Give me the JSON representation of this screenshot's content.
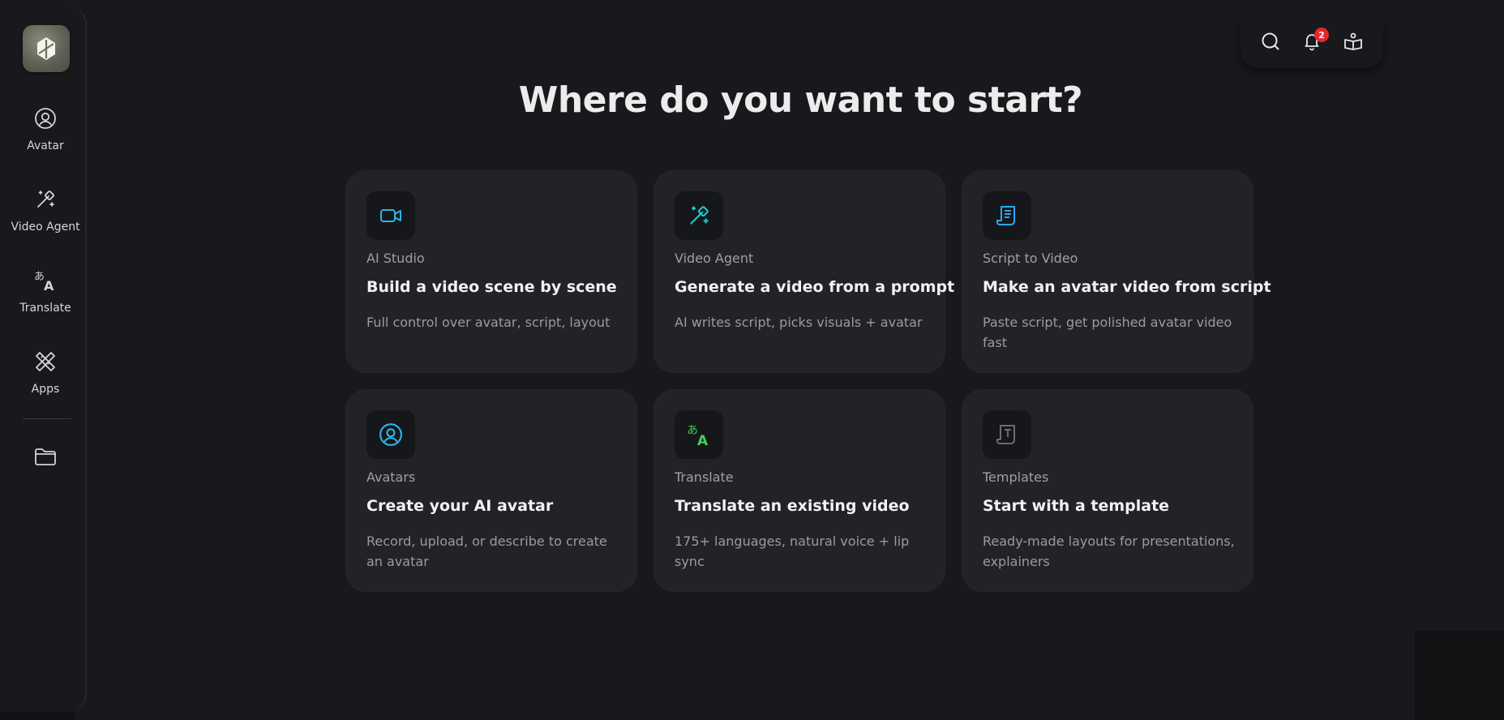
{
  "sidebar": {
    "logo_icon": "logo-mark-icon",
    "items": [
      {
        "label": "Avatar",
        "icon": "user-circle-icon"
      },
      {
        "label": "Video Agent",
        "icon": "magic-wand-icon"
      },
      {
        "label": "Translate",
        "icon": "translate-icon"
      },
      {
        "label": "Apps",
        "icon": "apps-tools-icon"
      },
      {
        "label": "",
        "icon": "folder-icon"
      }
    ]
  },
  "toolbar": {
    "search_icon": "search-icon",
    "notifications_icon": "bell-icon",
    "notifications_count": "2",
    "guide_icon": "open-book-icon"
  },
  "main": {
    "title": "Where do you want to start?",
    "cards": [
      {
        "kicker": "AI Studio",
        "title": "Build a video scene by scene",
        "desc": "Full control over avatar, script, layout",
        "icon": "video-camera-icon",
        "icon_color": "#2cb3e8"
      },
      {
        "kicker": "Video Agent",
        "title": "Generate a video from a prompt",
        "desc": "AI writes script, picks visuals + avatar",
        "icon": "magic-wand-icon",
        "icon_color": "#1fc6cf"
      },
      {
        "kicker": "Script to Video",
        "title": "Make an avatar video from script",
        "desc": "Paste script, get polished avatar video fast",
        "icon": "script-document-icon",
        "icon_color": "#2aa9ee"
      },
      {
        "kicker": "Avatars",
        "title": "Create your AI avatar",
        "desc": "Record, upload, or describe to create an avatar",
        "icon": "user-circle-icon",
        "icon_color": "#2cb3e8"
      },
      {
        "kicker": "Translate",
        "title": "Translate an existing video",
        "desc": "175+ languages, natural voice + lip sync",
        "icon": "translate-icon",
        "icon_color": "#3fcf5a"
      },
      {
        "kicker": "Templates",
        "title": "Start with a template",
        "desc": "Ready-made layouts for presentations, explainers",
        "icon": "template-icon",
        "icon_color": "#6c6d72"
      }
    ]
  }
}
